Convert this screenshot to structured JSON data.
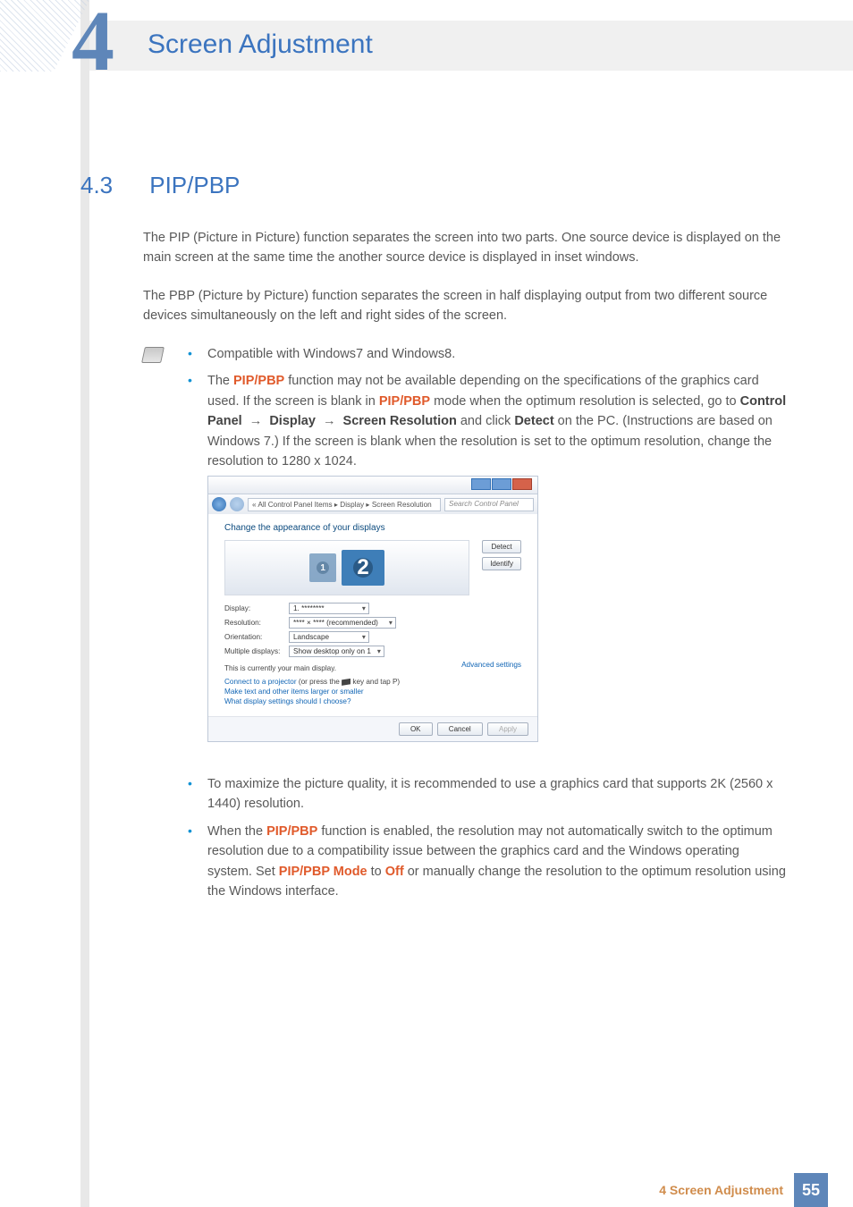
{
  "chapter": {
    "number": "4",
    "title": "Screen Adjustment"
  },
  "section": {
    "number": "4.3",
    "title": "PIP/PBP"
  },
  "para1": "The PIP (Picture in Picture) function separates the screen into two parts. One source device is displayed on the main screen at the same time the another source device is displayed in inset windows.",
  "para2": "The PBP (Picture by Picture) function separates the screen in half displaying output from two different source devices simultaneously on the left and right sides of the screen.",
  "bullets1": {
    "b1": "Compatible with Windows7 and Windows8.",
    "b2_pre": "The ",
    "b2_hl1": "PIP/PBP",
    "b2_mid": " function may not be available depending on the specifications of the graphics card used. If the screen is blank in ",
    "b2_hl2": "PIP/PBP",
    "b2_mid2": " mode when the optimum resolution is selected, go to ",
    "b2_em1": "Control Panel",
    "b2_arrow": " → ",
    "b2_em2": "Display",
    "b2_em3": "Screen Resolution",
    "b2_mid3": " and click ",
    "b2_em4": "Detect",
    "b2_tail": " on the PC. (Instructions are based on Windows 7.) If the screen is blank when the resolution is set to the optimum resolution, change the resolution to 1280 x 1024."
  },
  "figure": {
    "breadcrumb": "« All Control Panel Items ▸ Display ▸ Screen Resolution",
    "search_placeholder": "Search Control Panel",
    "heading": "Change the appearance of your displays",
    "btn_detect": "Detect",
    "btn_identify": "Identify",
    "label_display": "Display:",
    "val_display": "1. ********",
    "label_resolution": "Resolution:",
    "val_resolution": "**** × **** (recommended)",
    "label_orientation": "Orientation:",
    "val_orientation": "Landscape",
    "label_multiple": "Multiple displays:",
    "val_multiple": "Show desktop only on 1",
    "note_main": "This is currently your main display.",
    "link_advanced": "Advanced settings",
    "link_projector_a": "Connect to a projector",
    "link_projector_b": " (or press the ",
    "link_projector_c": " key and tap P)",
    "link_textsize": "Make text and other items larger or smaller",
    "link_whatset": "What display settings should I choose?",
    "btn_ok": "OK",
    "btn_cancel": "Cancel",
    "btn_apply": "Apply"
  },
  "bullets2": {
    "b3": "To maximize the picture quality, it is recommended to use a graphics card that supports 2K (2560 x 1440) resolution.",
    "b4_pre": "When the ",
    "b4_hl1": "PIP/PBP",
    "b4_mid": " function is enabled, the resolution may not automatically switch to the optimum resolution due to a compatibility issue between the graphics card and the Windows operating system. Set ",
    "b4_hl2": "PIP/PBP Mode",
    "b4_mid2": " to ",
    "b4_hl3": "Off",
    "b4_tail": " or manually change the resolution to the optimum resolution using the Windows interface."
  },
  "footer": {
    "text": "4 Screen Adjustment",
    "page": "55"
  }
}
